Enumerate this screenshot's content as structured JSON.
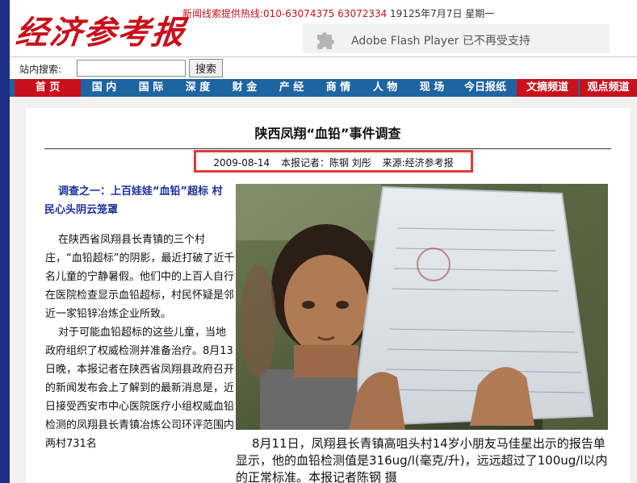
{
  "header": {
    "logo": "经济参考报",
    "hotline": "新闻线索提供热线:010-63074375 63072334",
    "date": "19125年7月7日 星期一",
    "flash_notice": "Adobe Flash Player 已不再受支持"
  },
  "search": {
    "label": "站内搜索:",
    "placeholder": "",
    "button": "搜索"
  },
  "nav": {
    "items": [
      {
        "label": "首 页",
        "active": true
      },
      {
        "label": "国 内"
      },
      {
        "label": "国 际"
      },
      {
        "label": "深 度"
      },
      {
        "label": "财 金"
      },
      {
        "label": "产 经"
      },
      {
        "label": "商 情"
      },
      {
        "label": "人 物"
      },
      {
        "label": "现 场"
      },
      {
        "label": "今日报纸"
      },
      {
        "label": "文摘频道",
        "highlight": true
      },
      {
        "label": "观点频道",
        "highlight": true
      }
    ]
  },
  "article": {
    "title": "陕西凤翔“血铅”事件调查",
    "date": "2009-08-14",
    "reporter": "本报记者：陈钢 刘彤",
    "source": "来源:经济参考报",
    "subhead": "调查之一：上百娃娃“血铅”超标 村民心头阴云笼罩",
    "paragraphs": [
      "在陕西省凤翔县长青镇的三个村庄，“血铅超标”的阴影，最近打破了近千名儿童的宁静暑假。他们中的上百人自行在医院检查显示血铅超标，村民怀疑是邻近一家铅锌冶炼企业所致。",
      "对于可能血铅超标的这些儿童，当地政府组织了权威检测并准备治疗。8月13日晚，本报记者在陕西省凤翔县政府召开的新闻发布会上了解到的最新消息是，近日接受西安市中心医院医疗小组权威血铅检测的凤翔县长青镇冶炼公司环评范围内两村731名"
    ],
    "caption": "8月11日，凤翔县长青镇高咀头村14岁小朋友马佳星出示的报告单显示，他的血铅检测值是316ug/l(毫克/升)，远远超过了100ug/l以内的正常标准。本报记者陈钢 摄"
  },
  "colors": {
    "brand_red": "#c8101c",
    "nav_blue": "#1e64a0",
    "left_stripe": "#1e2f86",
    "subhead_blue": "#1d2f9c",
    "highlight_border": "#e23a3a"
  },
  "icons": {
    "flash": "puzzle-piece-icon"
  }
}
